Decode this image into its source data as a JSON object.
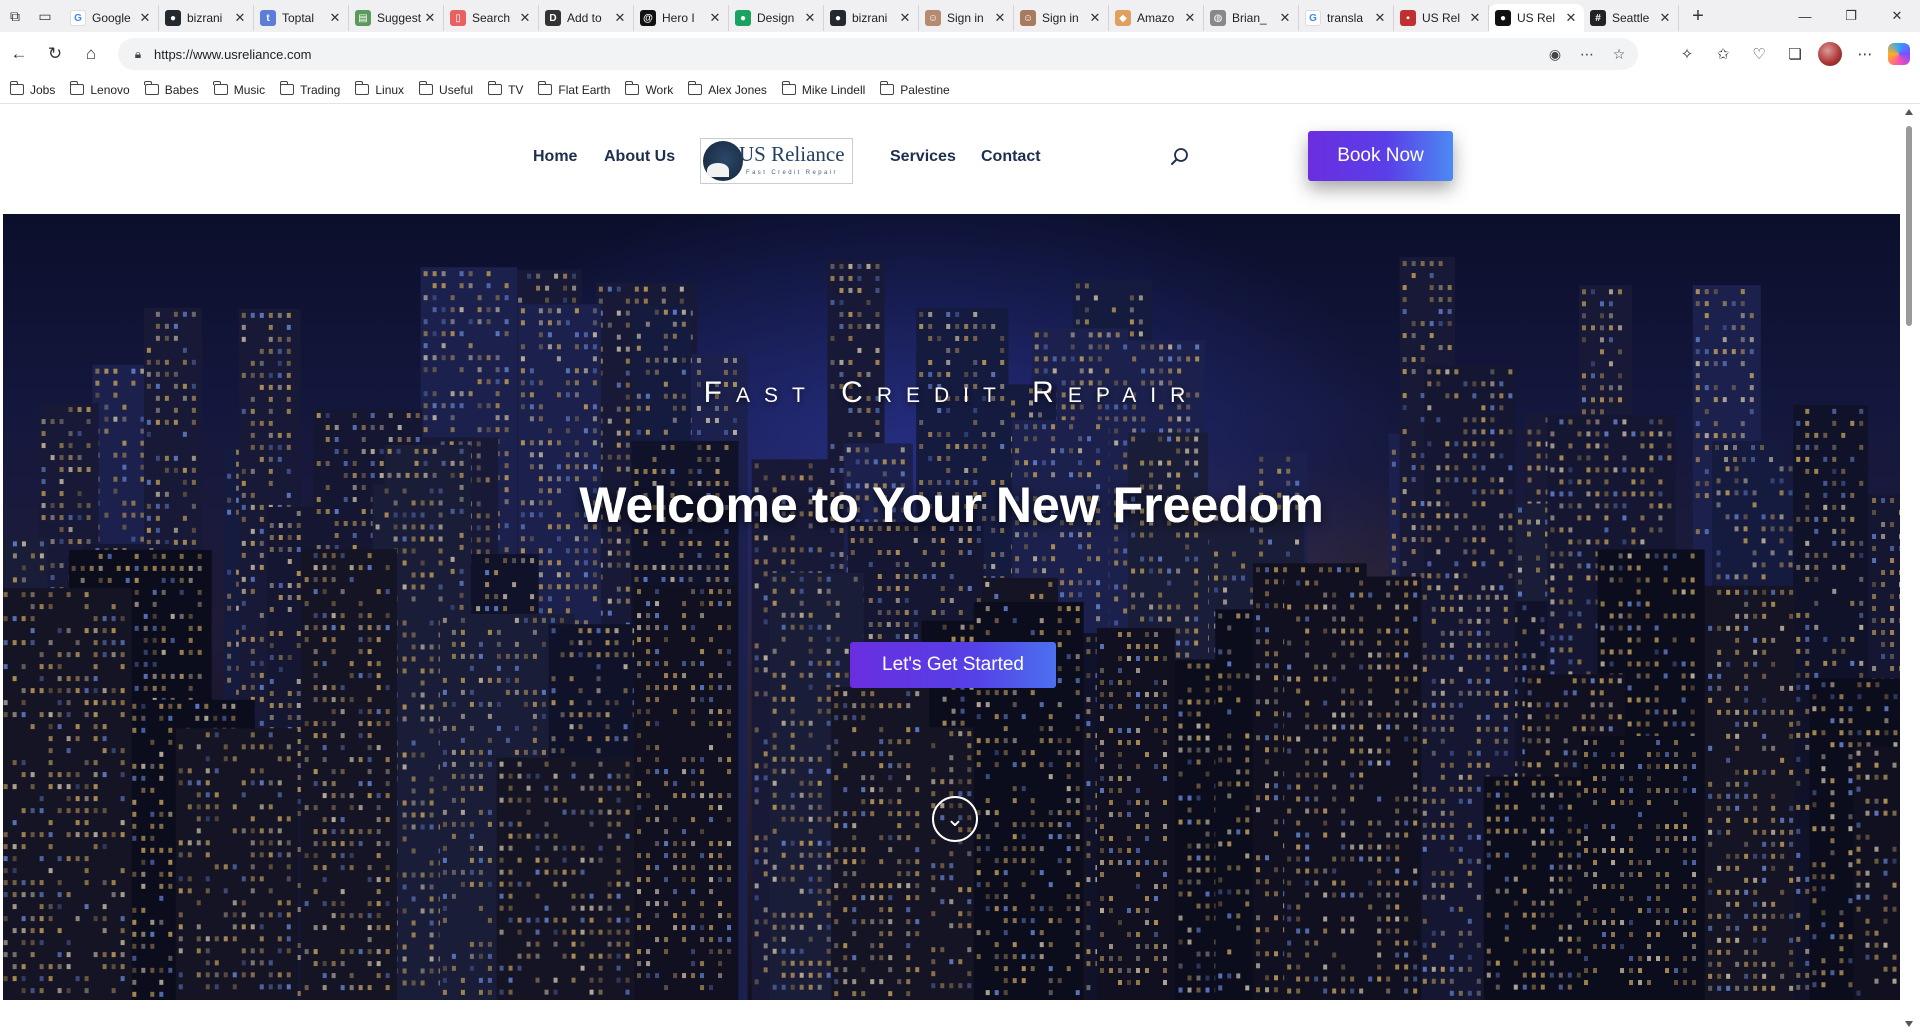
{
  "browser": {
    "tabs": [
      {
        "label": "Google",
        "icon": "google-icon",
        "color": "#ffffff",
        "glyph": "G"
      },
      {
        "label": "bizrani",
        "icon": "github-icon",
        "color": "#24292f",
        "glyph": "●"
      },
      {
        "label": "Toptal",
        "icon": "toptal-icon",
        "color": "#5b7fd8",
        "glyph": "t"
      },
      {
        "label": "Suggest",
        "icon": "doc-icon",
        "color": "#5a9a5a",
        "glyph": "▤"
      },
      {
        "label": "Search",
        "icon": "bookmark-app-icon",
        "color": "#e86060",
        "glyph": "▯"
      },
      {
        "label": "Add to",
        "icon": "dev-icon",
        "color": "#333333",
        "glyph": "D"
      },
      {
        "label": "Hero I",
        "icon": "threads-icon",
        "color": "#111111",
        "glyph": "@"
      },
      {
        "label": "Design",
        "icon": "design-icon",
        "color": "#1aa260",
        "glyph": "●"
      },
      {
        "label": "bizrani",
        "icon": "github-icon",
        "color": "#24292f",
        "glyph": "●"
      },
      {
        "label": "Sign in",
        "icon": "avatar-icon",
        "color": "#b48a70",
        "glyph": "☺"
      },
      {
        "label": "Sign in",
        "icon": "avatar-icon",
        "color": "#a87a60",
        "glyph": "☺"
      },
      {
        "label": "Amazo",
        "icon": "amazon-icon",
        "color": "#e0a060",
        "glyph": "◆"
      },
      {
        "label": "Brian_",
        "icon": "globe-icon",
        "color": "#888888",
        "glyph": "◍"
      },
      {
        "label": "transla",
        "icon": "google-icon",
        "color": "#ffffff",
        "glyph": "G"
      },
      {
        "label": "US Rel",
        "icon": "us-flag-icon",
        "color": "#c03030",
        "glyph": "▪"
      },
      {
        "label": "US Rel",
        "icon": "site-icon",
        "color": "#111111",
        "glyph": "●",
        "active": true
      },
      {
        "label": "Seattle",
        "icon": "hashtag-icon",
        "color": "#222222",
        "glyph": "#"
      }
    ],
    "url": "https://www.usreliance.com",
    "bookmarks": [
      "Jobs",
      "Lenovo",
      "Babes",
      "Music",
      "Trading",
      "Linux",
      "Useful",
      "TV",
      "Flat Earth",
      "Work",
      "Alex Jones",
      "Mike Lindell",
      "Palestine"
    ]
  },
  "site": {
    "nav": {
      "home": "Home",
      "about": "About Us",
      "services": "Services",
      "contact": "Contact"
    },
    "logo": {
      "brand": "US Reliance",
      "tagline": "Fast Credit Repair"
    },
    "book_button": "Book Now",
    "hero": {
      "subtitle": "Fast Credit Repair",
      "title": "Welcome to Your New Freedom",
      "cta": "Let's Get Started"
    }
  },
  "colors": {
    "nav_text": "#1d2f4f",
    "accent_purple": "#6a2ee0",
    "accent_blue": "#4c8af2"
  }
}
